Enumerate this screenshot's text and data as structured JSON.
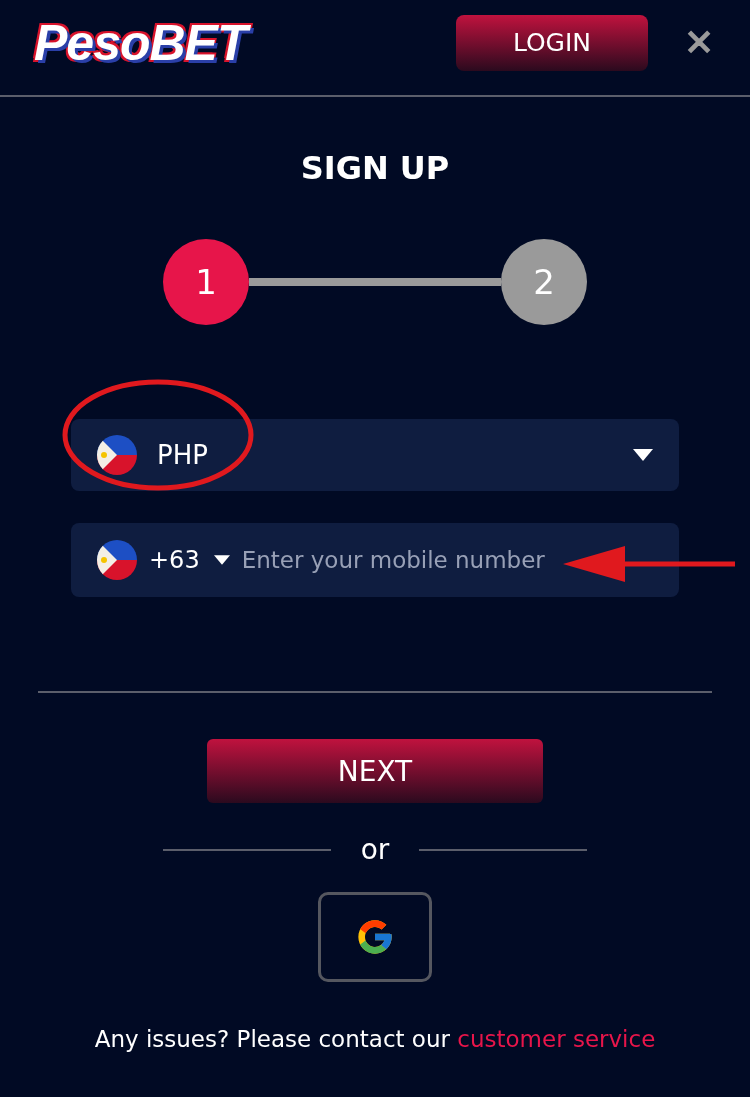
{
  "header": {
    "logo": "PesoBET",
    "login_button": "LOGIN",
    "close": "✕"
  },
  "title": "SIGN UP",
  "steps": [
    {
      "label": "1",
      "selected": true
    },
    {
      "label": "2",
      "selected": false
    }
  ],
  "currency_select": {
    "value": "PHP"
  },
  "phone_field": {
    "country_code": "+63",
    "placeholder": "Enter your mobile number"
  },
  "next_button": "NEXT",
  "separator": "or",
  "footer": {
    "text": "Any issues? Please contact our",
    "link": "customer service"
  }
}
